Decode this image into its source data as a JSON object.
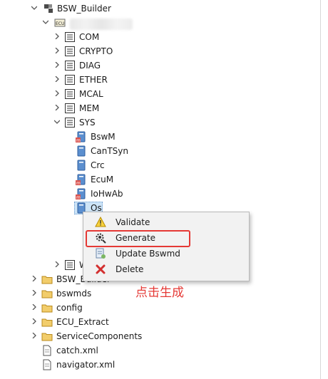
{
  "tree": {
    "root": {
      "label": "BSW_Builder"
    },
    "ecu_node": {
      "label": "ECU"
    },
    "folders": [
      {
        "label": "COM"
      },
      {
        "label": "CRYPTO"
      },
      {
        "label": "DIAG"
      },
      {
        "label": "ETHER"
      },
      {
        "label": "MCAL"
      },
      {
        "label": "MEM"
      },
      {
        "label": "SYS"
      }
    ],
    "sys_children": [
      {
        "label": "BswM"
      },
      {
        "label": "CanTSyn"
      },
      {
        "label": "Crc"
      },
      {
        "label": "EcuM"
      },
      {
        "label": "IoHwAb"
      },
      {
        "label": "Os"
      }
    ],
    "wd_partial": {
      "label": "WD"
    },
    "project_items": [
      {
        "label": "BSW_Builder"
      },
      {
        "label": "bswmds"
      },
      {
        "label": "config"
      },
      {
        "label": "ECU_Extract"
      },
      {
        "label": "ServiceComponents"
      },
      {
        "label": "catch.xml"
      },
      {
        "label": "navigator.xml"
      }
    ]
  },
  "context_menu": {
    "items": [
      {
        "label": "Validate",
        "icon": "warning-icon"
      },
      {
        "label": "Generate",
        "icon": "gear-generate-icon"
      },
      {
        "label": "Update Bswmd",
        "icon": "update-icon"
      },
      {
        "label": "Delete",
        "icon": "delete-icon"
      }
    ]
  },
  "annotation": {
    "text": "点击生成"
  },
  "colors": {
    "highlight_box": "#e53935",
    "selection": "#cde4f7",
    "folder": "#e8b94a",
    "module": "#4a7ebb"
  }
}
